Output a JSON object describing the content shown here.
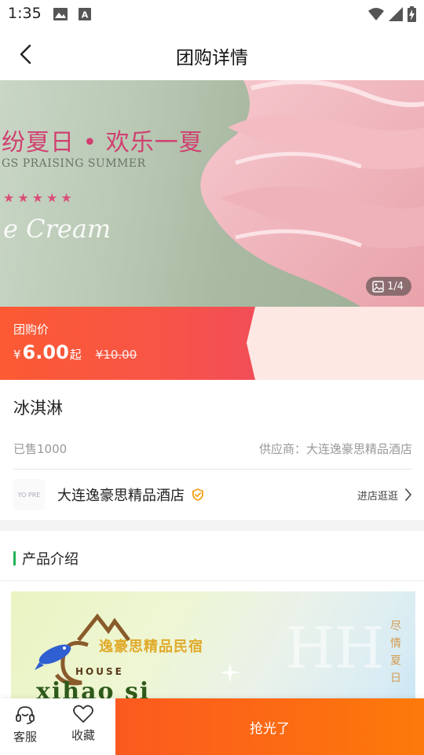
{
  "status_bar": {
    "time": "1:35"
  },
  "header": {
    "title": "团购详情"
  },
  "banner": {
    "headline": "纷夏日 • 欢乐一夏",
    "subline": "GS PRAISING SUMMER",
    "stars": "★★★★★",
    "script_text": "e Cream",
    "counter": "1/4"
  },
  "price": {
    "label": "团购价",
    "currency": "¥",
    "value": "6.00",
    "suffix": "起",
    "original": "¥10.00"
  },
  "product": {
    "name": "冰淇淋",
    "sold": "已售1000",
    "supplier": "供应商：大连逸豪思精品酒店"
  },
  "store": {
    "logo_text": "YO PRE",
    "name": "大连逸豪思精品酒店",
    "visit_label": "进店逛逛"
  },
  "intro": {
    "title": "产品介绍",
    "image": {
      "brand_cn": "逸豪思精品民宿",
      "house": "HOUSE",
      "pinyin": "xihao si",
      "vertical": "尽情夏日",
      "big_letter": "HH"
    }
  },
  "bottom_bar": {
    "service_label": "客服",
    "favorite_label": "收藏",
    "buy_label": "抢光了"
  },
  "colors": {
    "accent_orange": "#fc6c12",
    "price_red": "#f85546",
    "intro_bar_green": "#22b455",
    "verify_orange": "#f5a623"
  }
}
